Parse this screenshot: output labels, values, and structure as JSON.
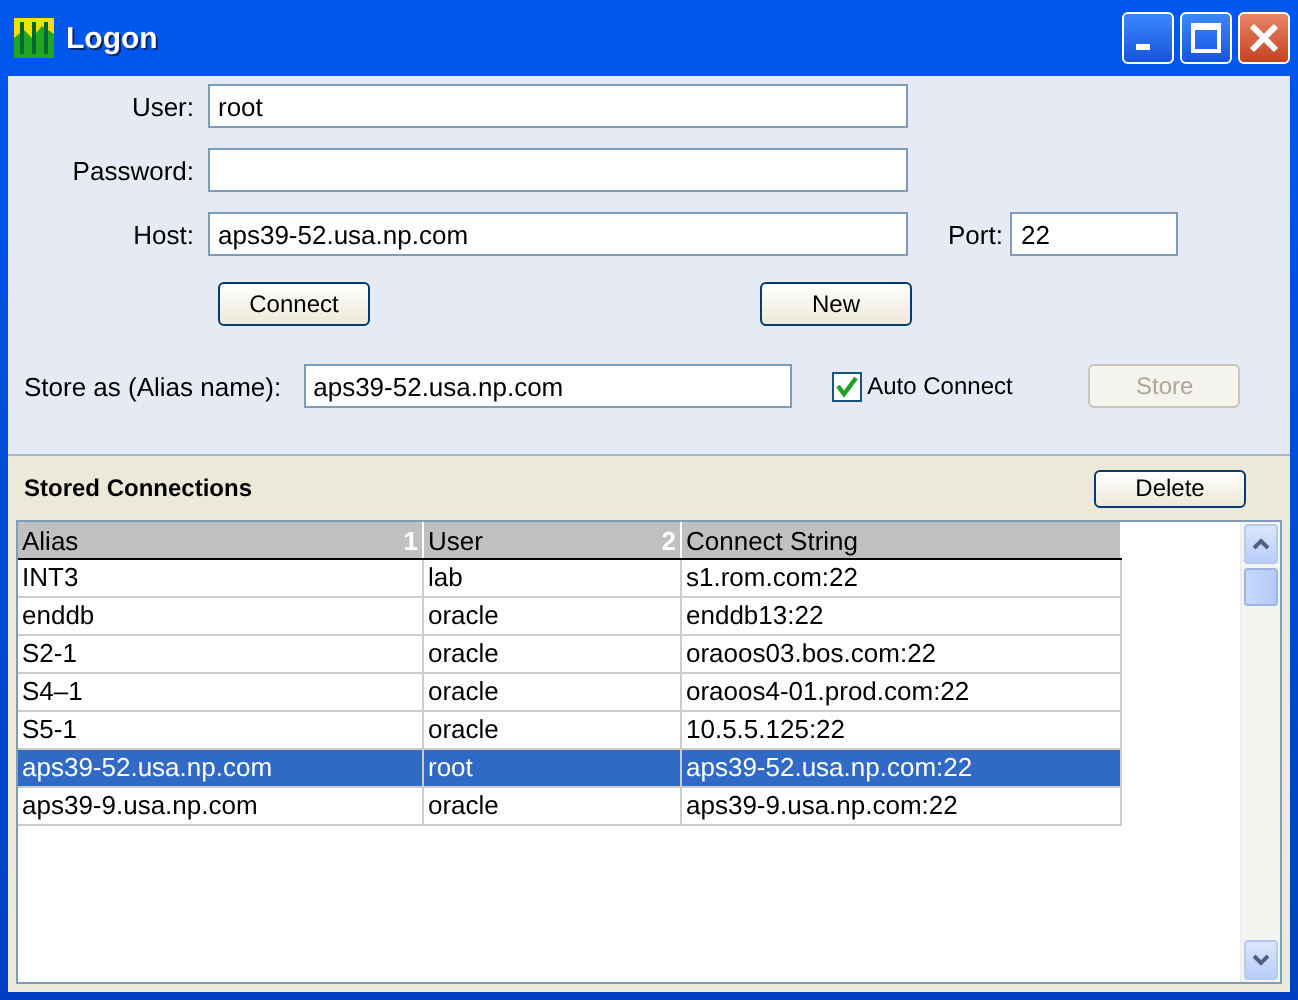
{
  "window": {
    "title": "Logon"
  },
  "form": {
    "user": {
      "label": "User:",
      "value": "root"
    },
    "password": {
      "label": "Password:"
    },
    "host": {
      "label": "Host:",
      "value": "aps39-52.usa.np.com"
    },
    "port": {
      "label": "Port:",
      "value": "22"
    }
  },
  "buttons": {
    "connect": "Connect",
    "new": "New"
  },
  "store": {
    "label": "Store as (Alias name):",
    "value": "aps39-52.usa.np.com",
    "auto_connect": {
      "label": "Auto Connect",
      "checked": true
    },
    "button": {
      "label": "Store",
      "disabled": true
    }
  },
  "stored": {
    "title": "Stored Connections",
    "delete": "Delete"
  },
  "table": {
    "columns": [
      {
        "label": "Alias",
        "sort": "1"
      },
      {
        "label": "User",
        "sort": "2"
      },
      {
        "label": "Connect String"
      }
    ],
    "rows": [
      {
        "cells": [
          "INT3",
          "lab",
          "s1.rom.com:22"
        ],
        "selected": false
      },
      {
        "cells": [
          "enddb",
          "oracle",
          "enddb13:22"
        ],
        "selected": false
      },
      {
        "cells": [
          "S2-1",
          "oracle",
          "oraoos03.bos.com:22"
        ],
        "selected": false
      },
      {
        "cells": [
          "S4–1",
          "oracle",
          "oraoos4-01.prod.com:22"
        ],
        "selected": false
      },
      {
        "cells": [
          "S5-1",
          "oracle",
          "10.5.5.125:22"
        ],
        "selected": false
      },
      {
        "cells": [
          "aps39-52.usa.np.com",
          "root",
          "aps39-52.usa.np.com:22"
        ],
        "selected": true
      },
      {
        "cells": [
          "aps39-9.usa.np.com",
          "oracle",
          "aps39-9.usa.np.com:22"
        ],
        "selected": false
      }
    ]
  }
}
